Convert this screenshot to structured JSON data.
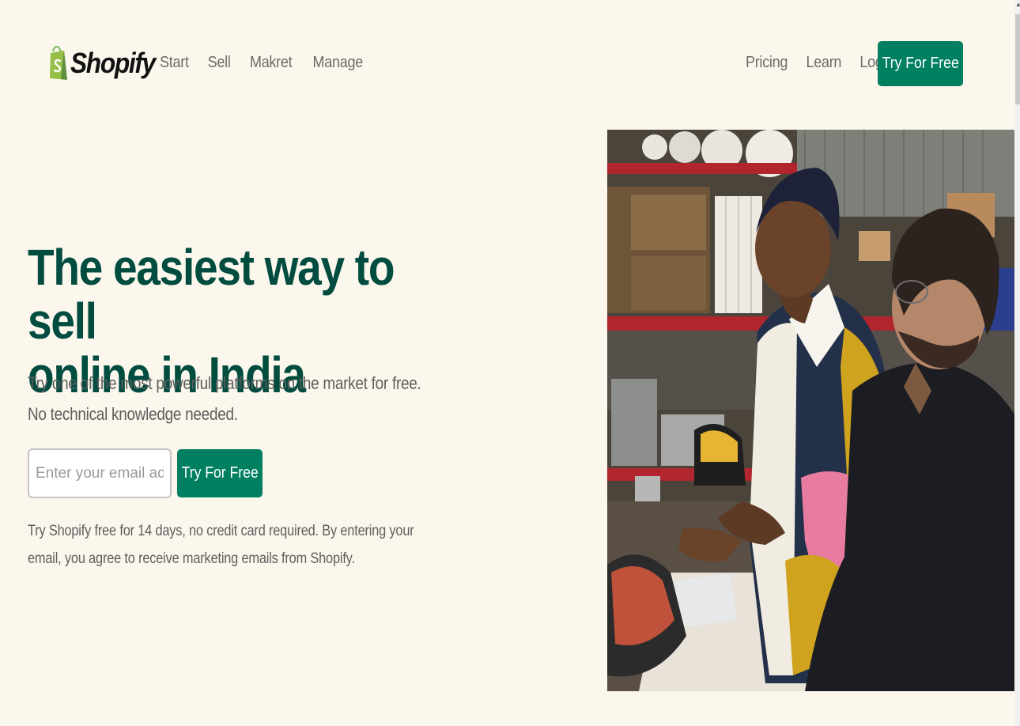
{
  "brand": {
    "name": "Shopify",
    "color": "#008060",
    "title_color": "#004c3f"
  },
  "nav": {
    "links": [
      "Start",
      "Sell",
      "Makret",
      "Manage"
    ],
    "right_links": [
      "Pricing",
      "Learn",
      "Login"
    ],
    "cta": "Try For Free"
  },
  "hero": {
    "title_line1": "The easiest way to sell",
    "title_line2": "online in India",
    "subtitle": "Try one of the most powerful platforms on the market for free. No technical knowledge needed.",
    "email_placeholder": "Enter your email address",
    "cta": "Try For Free",
    "disclaimer": "Try Shopify free for 14 days, no credit card required. By entering your email, you agree to receive marketing emails from Shopify."
  },
  "icons": {
    "logo": "shopify-bag-icon",
    "scroll_up": "scroll-up-arrow-icon"
  }
}
